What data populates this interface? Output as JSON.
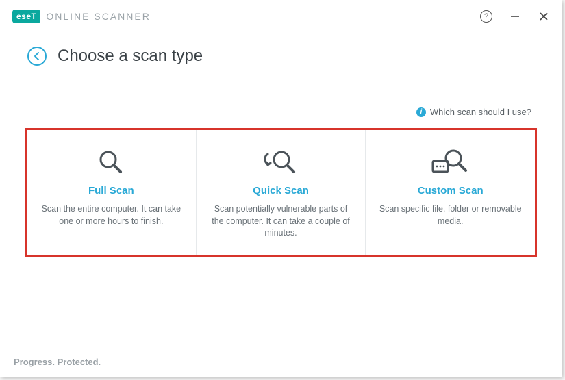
{
  "app": {
    "logo_badge": "eseT",
    "logo_text": "ONLINE SCANNER"
  },
  "header": {
    "title": "Choose a scan type"
  },
  "hint": {
    "text": "Which scan should I use?"
  },
  "cards": {
    "full": {
      "title": "Full Scan",
      "desc": "Scan the entire computer. It can take one or more hours to finish."
    },
    "quick": {
      "title": "Quick Scan",
      "desc": "Scan potentially vulnerable parts of the computer. It can take a couple of minutes."
    },
    "custom": {
      "title": "Custom Scan",
      "desc": "Scan specific file, folder or removable media."
    }
  },
  "footer": {
    "tagline": "Progress. Protected."
  }
}
